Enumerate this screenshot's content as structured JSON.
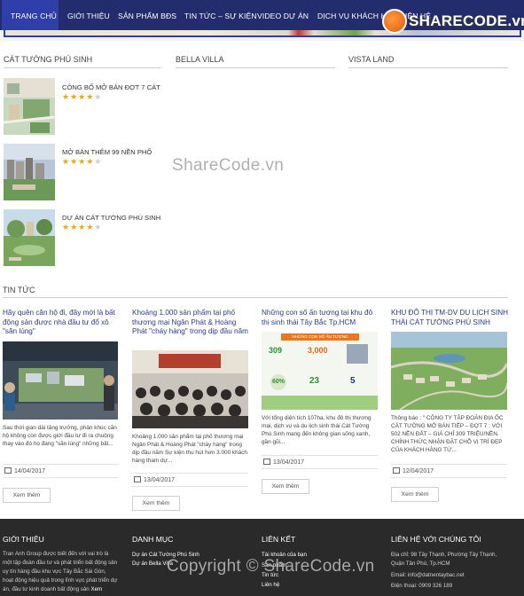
{
  "nav": {
    "items": [
      {
        "label": "TRANG CHỦ",
        "active": true
      },
      {
        "label": "GIỚI THIỆU",
        "active": false
      },
      {
        "label": "SẢN PHẨM BĐS",
        "active": false
      },
      {
        "label": "TIN TỨC – SỰ KIỆN",
        "active": false
      },
      {
        "label": "VIDEO DỰ ÁN",
        "active": false
      },
      {
        "label": "DỊCH VỤ KHÁCH HÀNG",
        "active": false
      },
      {
        "label": "LIÊN HỆ",
        "active": false
      }
    ]
  },
  "watermark": {
    "logo_text": "SHARECODE.vn",
    "middle": "ShareCode.vn",
    "footer": "Copyright © ShareCode.vn"
  },
  "projects": {
    "tabs": [
      "CÁT TƯỜNG PHÚ SINH",
      "BELLA VILLA",
      "VISTA LAND"
    ],
    "items": [
      {
        "title": "CÔNG BỐ MỞ BÁN ĐỢT 7 CÁT",
        "rating": 4,
        "stars_on": "★★★★",
        "stars_off": "★"
      },
      {
        "title": "MỞ BÁN THÊM 99 NỀN PHỐ",
        "rating": 4,
        "stars_on": "★★★★",
        "stars_off": "★"
      },
      {
        "title": "DỰ ÁN CÁT TƯỜNG PHÚ SINH",
        "rating": 4,
        "stars_on": "★★★★",
        "stars_off": "★"
      }
    ]
  },
  "news": {
    "heading": "TIN TỨC",
    "more_label": "Xem thêm",
    "items": [
      {
        "title": "Hãy quên căn hộ đi, đây mới là bất động sản được nhà đầu tư đổ xô \"săn lùng\"",
        "desc": "Sau thời gian dài tăng trưởng, phân khúc căn hộ không còn được giới đầu tư đi ra chuộng thay vào đó họ đang \"săn lùng\" những bất...",
        "date": "14/04/2017"
      },
      {
        "title": "Khoảng 1.000 sản phẩm tại phố thương mại Ngân Phát & Hoàng Phát \"cháy hàng\" trong dịp đầu năm",
        "desc": "Khoảng 1.000 sản phẩm tại phố thương mại Ngân Phát & Hoàng Phát \"cháy hàng\" trong dịp đầu năm Sự kiện thu hút hơn 3.000 khách hàng tham dự...",
        "date": "13/04/2017"
      },
      {
        "title": "Những con số ấn tượng tại khu đô thị sinh thái Tây Bắc Tp.HCM",
        "desc": "Với tổng diện tích 107ha, khu đô thị thương mại, dịch vụ và du lịch sinh thái Cát Tường Phú Sinh mang đến không gian sống xanh, gần gũi...",
        "date": "13/04/2017",
        "infographic_header": "NHỮNG CON SỐ ẤN TƯỢNG",
        "infographic_nums": [
          "309",
          "3,000",
          "60%",
          "23",
          "5"
        ]
      },
      {
        "title": "KHU ĐÔ THỊ TM-DV DU LỊCH SINH THÁI CÁT TƯỜNG PHÚ SINH",
        "desc": "Thông báo : \" CÔNG TY TẬP ĐOÀN ĐỊA ỐC CÁT TƯỜNG MỞ BÁN TIẾP – ĐỢT 7 : VỚI 502 NỀN ĐẤT – GIÁ CHỈ 309 TRIỆU/NỀN. CHÍNH THỨC NHẬN ĐẶT CHỖ VỊ TRÍ ĐẸP CỦA KHÁCH HÀNG TỪ...",
        "date": "12/04/2017"
      }
    ]
  },
  "footer": {
    "about_title": "GIỚI THIỆU",
    "about_text": "Tran Anh Group được biết đến với vai trò là một tập đoàn đầu tư và phát triển bất động sản uy tín hàng đầu khu vực Tây Bắc Sài Gòn, hoạt động hiệu quả trong lĩnh vực phát triển dự án, đầu tư kinh doanh bất động sản",
    "about_more": "Xem",
    "category_title": "DANH MỤC",
    "categories": [
      "Dự án Cát Tường Phú Sinh",
      "Dự án Bella Villa"
    ],
    "links_title": "LIÊN KẾT",
    "links": [
      "Tài khoản của bạn",
      "Sản phẩm",
      "Tin tức",
      "Liên hệ"
    ],
    "contact_title": "LIÊN HỆ VỚI CHÚNG TÔI",
    "address": "Địa chỉ: 98 Tây Thạnh, Phường Tây Thạnh, Quận Tân Phú, Tp.HCM",
    "email": "Email: info@datnentaybac.net",
    "phone": "Điện thoại: 0909 326 189"
  }
}
